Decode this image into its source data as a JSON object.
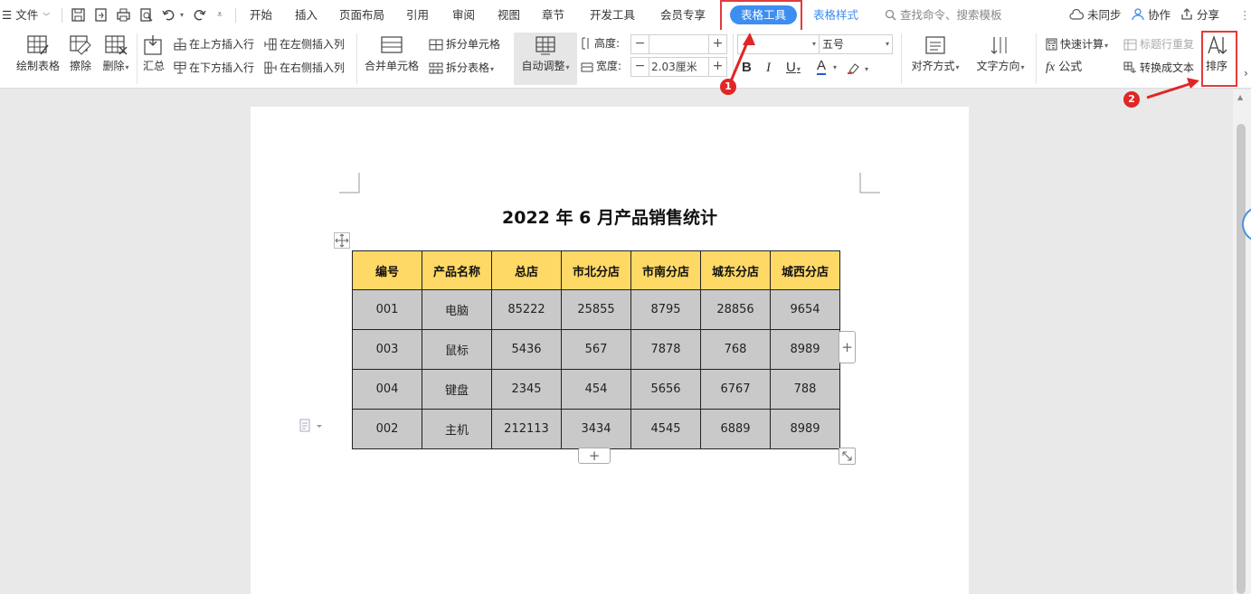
{
  "menubar": {
    "file_label": "文件",
    "tabs": [
      "开始",
      "插入",
      "页面布局",
      "引用",
      "审阅",
      "视图",
      "章节",
      "开发工具",
      "会员专享"
    ],
    "active_tab": "表格工具",
    "tab_table_style": "表格样式",
    "search_placeholder": "查找命令、搜索模板",
    "sync_label": "未同步",
    "collab_label": "协作",
    "share_label": "分享"
  },
  "ribbon": {
    "draw_table": "绘制表格",
    "erase": "擦除",
    "delete": "删除",
    "summary": "汇总",
    "insert_above": "在上方插入行",
    "insert_below": "在下方插入行",
    "insert_left": "在左侧插入列",
    "insert_right": "在右侧插入列",
    "merge_cells": "合并单元格",
    "split_cells": "拆分单元格",
    "split_table": "拆分表格",
    "auto_fit": "自动调整",
    "height_label": "高度:",
    "height_value": "",
    "width_label": "宽度:",
    "width_value": "2.03厘米",
    "font_name": "",
    "font_size": "五号",
    "align": "对齐方式",
    "text_dir": "文字方向",
    "quick_calc": "快速计算",
    "repeat_header": "标题行重复",
    "formula": "公式",
    "to_text": "转换成文本",
    "sort": "排序"
  },
  "annotations": {
    "badge1": "1",
    "badge2": "2",
    "accent_color": "#e23b3b"
  },
  "document": {
    "title": "2022 年 6 月产品销售统计",
    "headers": [
      "编号",
      "产品名称",
      "总店",
      "市北分店",
      "市南分店",
      "城东分店",
      "城西分店"
    ],
    "rows": [
      [
        "001",
        "电脑",
        "85222",
        "25855",
        "8795",
        "28856",
        "9654"
      ],
      [
        "003",
        "鼠标",
        "5436",
        "567",
        "7878",
        "768",
        "8989"
      ],
      [
        "004",
        "键盘",
        "2345",
        "454",
        "5656",
        "6767",
        "788"
      ],
      [
        "002",
        "主机",
        "212113",
        "3434",
        "4545",
        "6889",
        "8989"
      ]
    ],
    "header_color": "#ffd966",
    "cell_color": "#c9c9c9"
  }
}
